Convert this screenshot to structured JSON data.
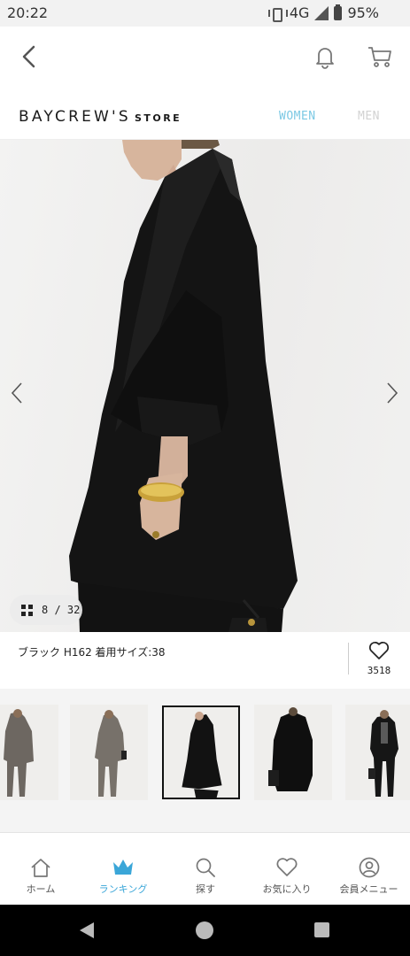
{
  "status_bar": {
    "time": "20:22",
    "network": "4G",
    "battery": "95%",
    "icons": [
      "vibrate-icon",
      "signal-icon",
      "battery-icon"
    ]
  },
  "app_bar": {
    "icons": [
      "back-arrow-icon",
      "bell-icon",
      "cart-icon"
    ]
  },
  "brand": {
    "logo_main": "BAYCREW'S",
    "logo_sub": "STORE",
    "nav_women": "WOMEN",
    "nav_men": "MEN",
    "colors": {
      "women_active": "#7cc9e4",
      "men_inactive": "#d2d2d2"
    }
  },
  "gallery": {
    "counter": "8 / 32",
    "image_count_current": 8,
    "image_count_total": 32
  },
  "product_info": {
    "color_size_text": "ブラック H162 着用サイズ:38",
    "favorite_count": "3518"
  },
  "thumbnails": {
    "count": 5,
    "selected_index": 2
  },
  "tab_bar": {
    "items": [
      {
        "label": "ホーム",
        "icon": "home-icon",
        "active": false
      },
      {
        "label": "ランキング",
        "icon": "crown-icon",
        "active": true
      },
      {
        "label": "探す",
        "icon": "search-icon",
        "active": false
      },
      {
        "label": "お気に入り",
        "icon": "heart-icon",
        "active": false
      },
      {
        "label": "会員メニュー",
        "icon": "user-icon",
        "active": false
      }
    ],
    "accent_color": "#3aa6d8"
  }
}
